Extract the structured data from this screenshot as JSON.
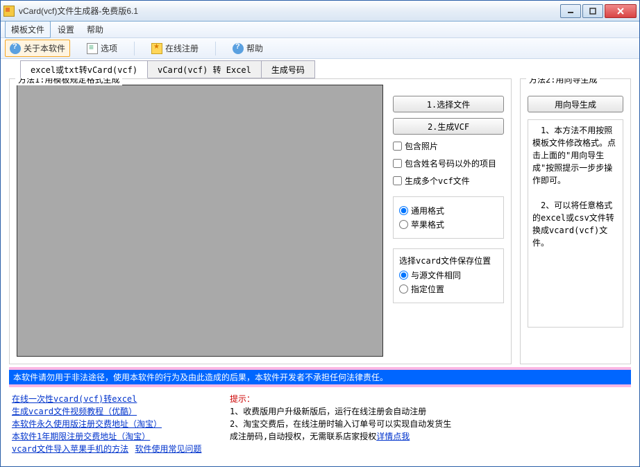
{
  "window": {
    "title": "vCard(vcf)文件生成器-免费版6.1"
  },
  "menubar": {
    "items": [
      {
        "label": "模板文件",
        "active": true
      },
      {
        "label": "设置"
      },
      {
        "label": "帮助"
      }
    ]
  },
  "toolbar": {
    "items": [
      {
        "label": "关于本软件",
        "icon": "about",
        "active": true
      },
      {
        "label": "选项",
        "icon": "opts"
      },
      {
        "label": "在线注册",
        "icon": "reg"
      },
      {
        "label": "帮助",
        "icon": "help"
      }
    ]
  },
  "tabs": [
    {
      "label": "excel或txt转vCard(vcf)",
      "active": true
    },
    {
      "label": "vCard(vcf) 转 Excel"
    },
    {
      "label": "生成号码"
    }
  ],
  "method1": {
    "legend": "方法1:用模板规定格式生成",
    "btn_select": "1.选择文件",
    "btn_gen": "2.生成VCF",
    "check_photo": "包含照片",
    "check_extra": "包含姓名号码以外的项目",
    "check_multi": "生成多个vcf文件",
    "fmt_common": "通用格式",
    "fmt_apple": "苹果格式",
    "save_label": "选择vcard文件保存位置",
    "save_same": "与源文件相同",
    "save_spec": "指定位置"
  },
  "method2": {
    "legend": "方法2:用向导生成",
    "btn": "用向导生成",
    "desc": "　1、本方法不用按照模板文件修改格式。点击上面的\"用向导生成\"按照提示一步步操作即可。\n\n　2、可以将任意格式的excel或csv文件转换成vcard(vcf)文件。"
  },
  "banner": "本软件请勿用于非法途径，使用本软件的行为及由此造成的后果，本软件开发者不承担任何法律责任。",
  "footer": {
    "links": [
      "在线一次性vcard(vcf)转excel",
      "生成vcard文件视频教程（优酷）",
      "本软件永久使用版注册交费地址（淘宝）",
      "本软件1年期限注册交费地址（淘宝）",
      "vcard文件导入苹果手机的方法"
    ],
    "link_inline": "软件使用常见问题",
    "hints_title": "提示：",
    "hints_1": "1、收费版用户升级新版后，运行在线注册会自动注册",
    "hints_2": "2、淘宝交费后，在线注册时输入订单号可以实现自动发货生成注册码,自动授权，无需联系店家授权",
    "hints_link": "详情点我"
  }
}
